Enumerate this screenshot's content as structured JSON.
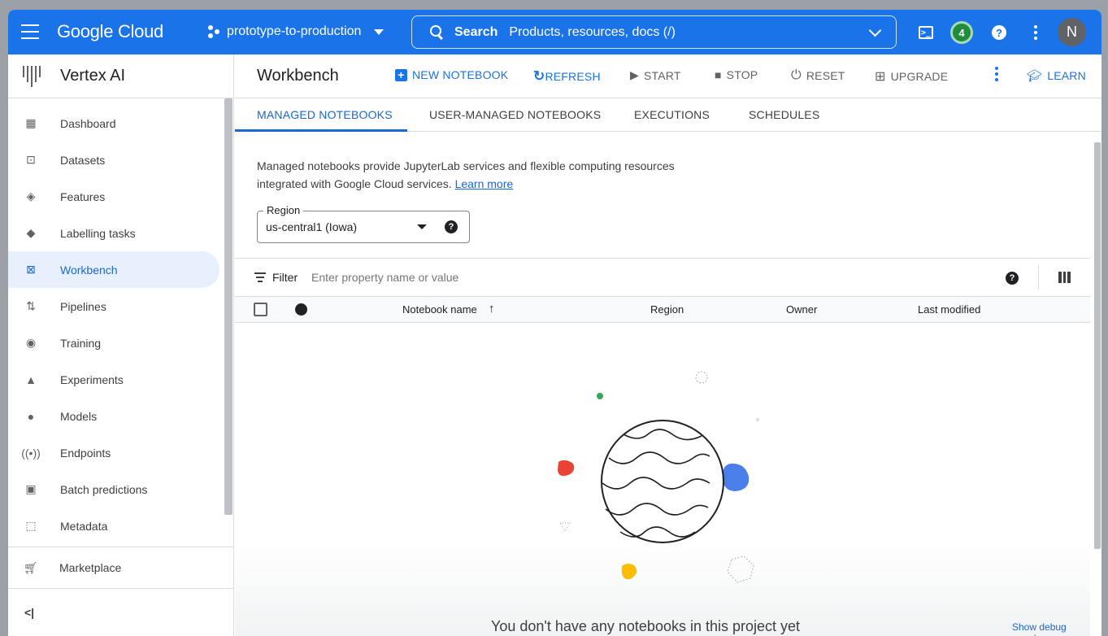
{
  "topbar": {
    "logo": "Google Cloud",
    "project": "prototype-to-production",
    "search_label": "Search",
    "search_placeholder": "Products, resources, docs (/)",
    "notification_count": "4",
    "avatar_initial": "N"
  },
  "sidebar": {
    "product": "Vertex AI",
    "items": [
      {
        "label": "Dashboard",
        "icon": "dashboard-icon"
      },
      {
        "label": "Datasets",
        "icon": "datasets-icon"
      },
      {
        "label": "Features",
        "icon": "features-icon"
      },
      {
        "label": "Labelling tasks",
        "icon": "tag-icon"
      },
      {
        "label": "Workbench",
        "icon": "workbench-icon",
        "active": true
      },
      {
        "label": "Pipelines",
        "icon": "pipelines-icon"
      },
      {
        "label": "Training",
        "icon": "training-icon"
      },
      {
        "label": "Experiments",
        "icon": "flask-icon"
      },
      {
        "label": "Models",
        "icon": "lightbulb-icon"
      },
      {
        "label": "Endpoints",
        "icon": "endpoints-icon"
      },
      {
        "label": "Batch predictions",
        "icon": "batch-icon"
      },
      {
        "label": "Metadata",
        "icon": "metadata-icon"
      }
    ],
    "marketplace": "Marketplace",
    "collapse": "<|"
  },
  "header": {
    "title": "Workbench",
    "new_notebook": "NEW NOTEBOOK",
    "refresh": "REFRESH",
    "start": "START",
    "stop": "STOP",
    "reset": "RESET",
    "upgrade": "UPGRADE",
    "learn": "LEARN"
  },
  "tabs": [
    "MANAGED NOTEBOOKS",
    "USER-MANAGED NOTEBOOKS",
    "EXECUTIONS",
    "SCHEDULES"
  ],
  "description": {
    "line1": "Managed notebooks provide JupyterLab services and flexible computing resources",
    "line2": "integrated with Google Cloud services.",
    "link": "Learn more"
  },
  "region": {
    "label": "Region",
    "value": "us-central1 (Iowa)"
  },
  "filter": {
    "label": "Filter",
    "placeholder": "Enter property name or value"
  },
  "table": {
    "columns": [
      "Notebook name",
      "Region",
      "Owner",
      "Last modified"
    ],
    "sort_indicator": "↑"
  },
  "empty_state": {
    "message": "You don't have any notebooks in this project yet",
    "debug_link": "Show debug panel"
  },
  "colors": {
    "accent": "#1a73e8",
    "active_nav": "#e8f0fe"
  }
}
